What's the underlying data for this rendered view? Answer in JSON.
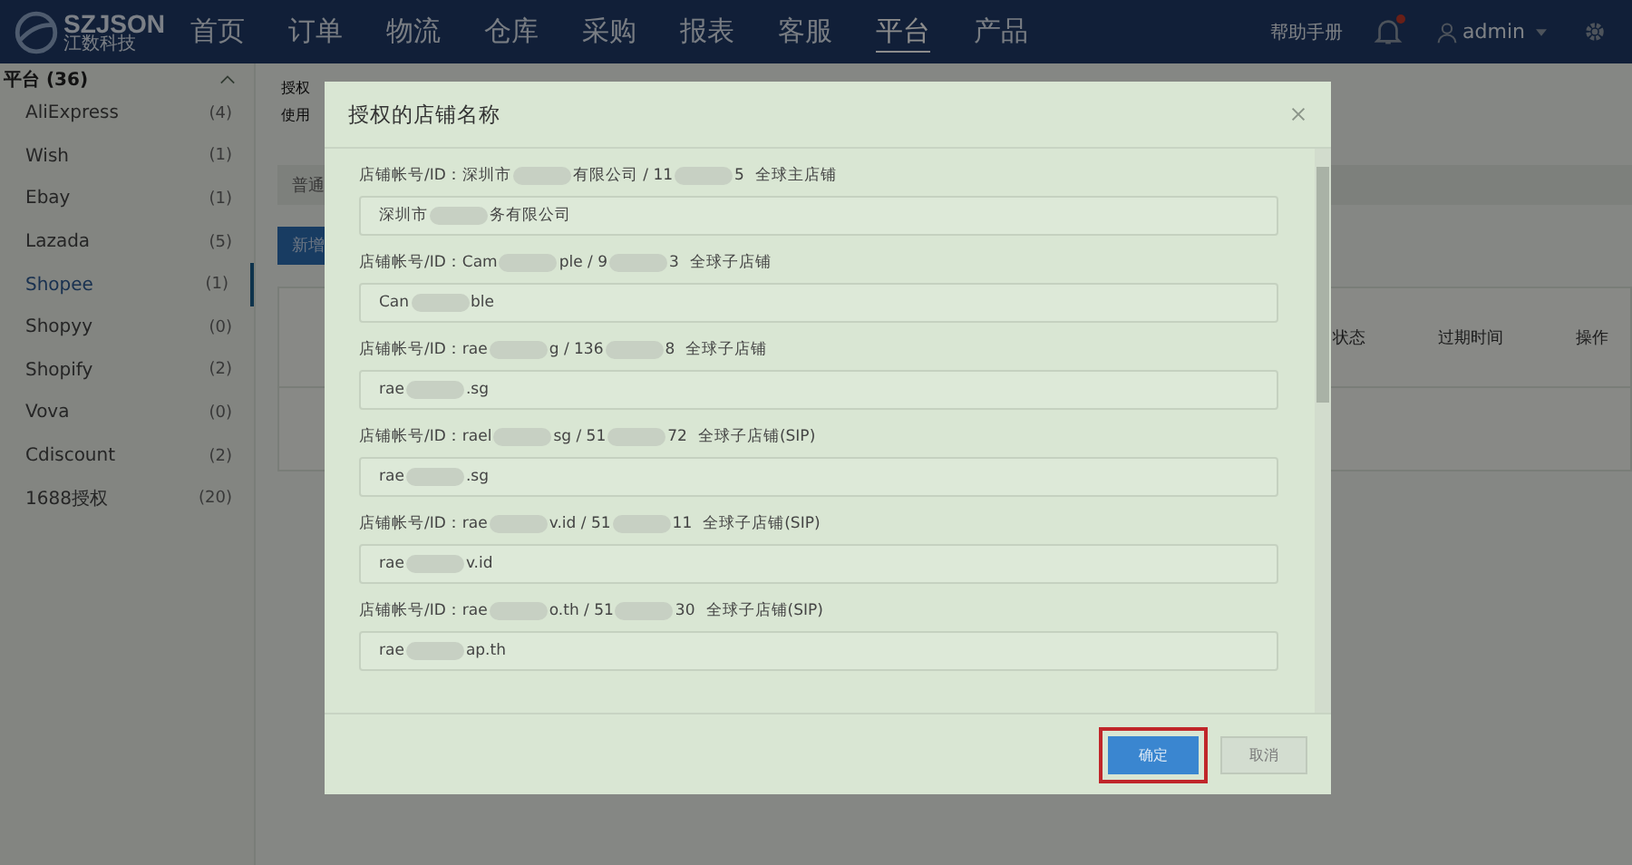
{
  "nav": {
    "logo": "SZJSON",
    "logo_sub": "江数科技",
    "items": [
      {
        "label": "首页",
        "selected": false
      },
      {
        "label": "订单",
        "selected": false
      },
      {
        "label": "物流",
        "selected": false
      },
      {
        "label": "仓库",
        "selected": false
      },
      {
        "label": "采购",
        "selected": false
      },
      {
        "label": "报表",
        "selected": false
      },
      {
        "label": "客服",
        "selected": false
      },
      {
        "label": "平台",
        "selected": true
      },
      {
        "label": "产品",
        "selected": false
      }
    ],
    "help": "帮助手册",
    "notification_dot": true,
    "user": "admin"
  },
  "sidebar": {
    "title": "平台 (36)",
    "items": [
      {
        "label": "AliExpress",
        "count": "(4)",
        "selected": false
      },
      {
        "label": "Wish",
        "count": "(1)",
        "selected": false
      },
      {
        "label": "Ebay",
        "count": "(1)",
        "selected": false
      },
      {
        "label": "Lazada",
        "count": "(5)",
        "selected": false
      },
      {
        "label": "Shopee",
        "count": "(1)",
        "selected": true
      },
      {
        "label": "Shopyy",
        "count": "(0)",
        "selected": false
      },
      {
        "label": "Shopify",
        "count": "(2)",
        "selected": false
      },
      {
        "label": "Vova",
        "count": "(0)",
        "selected": false
      },
      {
        "label": "Cdiscount",
        "count": "(2)",
        "selected": false
      },
      {
        "label": "1688授权",
        "count": "(20)",
        "selected": false
      }
    ]
  },
  "main": {
    "info_lines": [
      "授权",
      "使用"
    ],
    "tab": "普通",
    "add_button": "新增",
    "columns": [
      "状态",
      "过期时间",
      "操作"
    ]
  },
  "dialog": {
    "title": "授权的店铺名称",
    "stores": [
      {
        "label": [
          "店铺帐号/ID：深圳市",
          "有限公司 / 11",
          "5"
        ],
        "tag": "全球主店铺",
        "value": [
          "深圳市",
          "务有限公司"
        ]
      },
      {
        "label": [
          "店铺帐号/ID：Cam",
          "ple / 9",
          "3"
        ],
        "tag": "全球子店铺",
        "value": [
          "Can",
          "ble"
        ]
      },
      {
        "label": [
          "店铺帐号/ID：rae",
          "g / 136",
          "8"
        ],
        "tag": "全球子店铺",
        "value": [
          "rae",
          ".sg"
        ]
      },
      {
        "label": [
          "店铺帐号/ID：rael",
          "sg / 51",
          "72"
        ],
        "tag": "全球子店铺(SIP)",
        "value": [
          "rae",
          ".sg"
        ]
      },
      {
        "label": [
          "店铺帐号/ID：rae",
          "v.id / 51",
          "11"
        ],
        "tag": "全球子店铺(SIP)",
        "value": [
          "rae",
          "v.id"
        ]
      },
      {
        "label": [
          "店铺帐号/ID：rae",
          "o.th / 51",
          "30"
        ],
        "tag": "全球子店铺(SIP)",
        "value": [
          "rae",
          "ap.th"
        ]
      }
    ],
    "confirm": "确定",
    "cancel": "取消"
  }
}
